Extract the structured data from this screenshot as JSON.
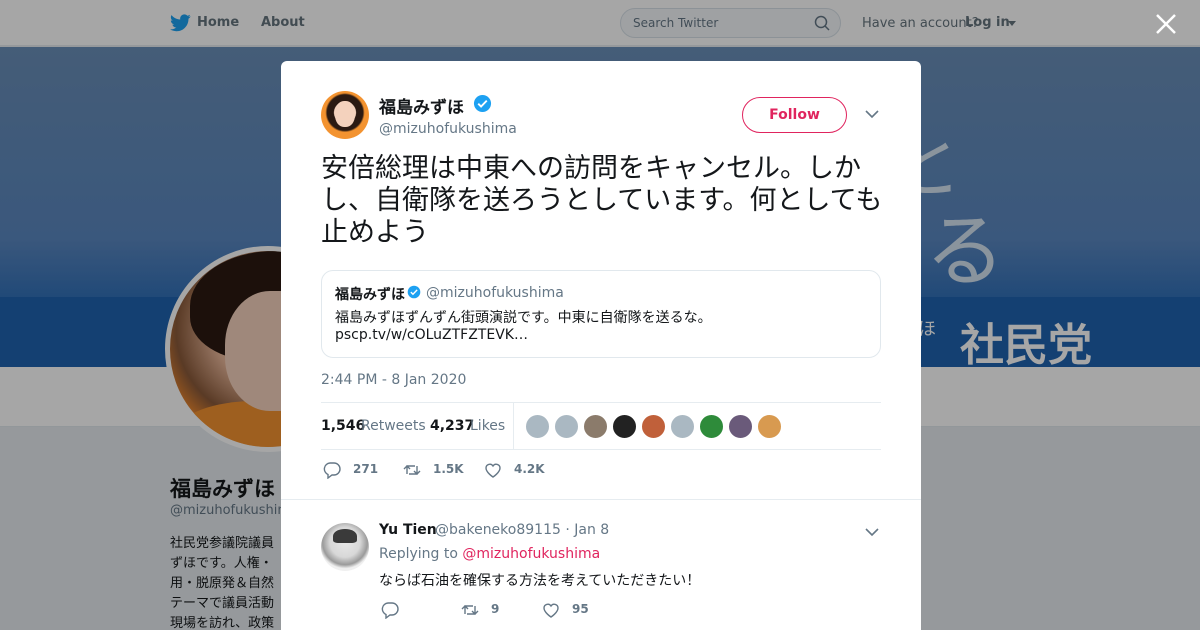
{
  "nav": {
    "home_label": "Home",
    "about_label": "About",
    "search_placeholder": "Search Twitter",
    "have_account": "Have an account?",
    "login_label": "Log in"
  },
  "profile": {
    "name": "福島みずほ",
    "handle": "@mizuhofukushima",
    "bio": "社民党参議院議員 ずほです。人権・ 用・脱原発＆自然 テーマで議員活動 現場を訪れ、政策"
  },
  "banner": {
    "char1": "と",
    "char2": "る",
    "party": "社民党",
    "ho": "ほ"
  },
  "tweet": {
    "author_name": "福島みずほ",
    "author_handle": "@mizuhofukushima",
    "follow_label": "Follow",
    "text": "安倍総理は中東への訪問をキャンセル。しかし、自衛隊を送ろうとしています。何としても止めよう",
    "timestamp": "2:44 PM - 8 Jan 2020",
    "quote": {
      "author_name": "福島みずほ",
      "author_handle": "@mizuhofukushima",
      "text": "福島みずほずんずん街頭演説です。中東に自衛隊を送るな。",
      "link": "pscp.tv/w/cOLuZTFZTEVK…"
    },
    "stats": {
      "retweets_count": "1,546",
      "retweets_label": "Retweets",
      "likes_count": "4,237",
      "likes_label": "Likes"
    },
    "liker_colors": [
      "#aab8c2",
      "#aab8c2",
      "#8b7b6b",
      "#222222",
      "#c0603a",
      "#aab8c2",
      "#2e8b3a",
      "#6a5a7a",
      "#d89a50"
    ],
    "actions": {
      "replies": "271",
      "retweets": "1.5K",
      "likes": "4.2K"
    }
  },
  "reply": {
    "author_name": "Yu Tien",
    "author_handle": "@bakeneko89115",
    "date": "· Jan 8",
    "replying_prefix": "Replying to ",
    "replying_to": "@mizuhofukushima",
    "text": "ならば石油を確保する方法を考えていただきたい！",
    "actions": {
      "replies": "",
      "retweets": "9",
      "likes": "95"
    }
  },
  "colors": {
    "accent": "#e0245e",
    "verified": "#1da1f2",
    "muted": "#657786"
  }
}
